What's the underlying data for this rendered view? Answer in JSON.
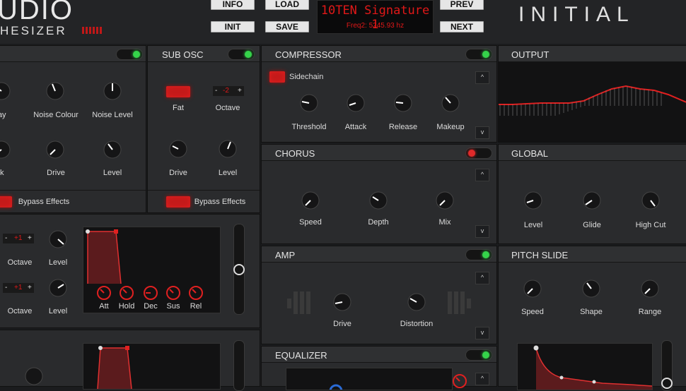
{
  "header": {
    "logo_main": "UDIO",
    "logo_sub": "HESIZER",
    "brand": "INITIAL",
    "buttons": {
      "info": "INFO",
      "load": "LOAD",
      "prev": "PREV",
      "init": "INIT",
      "save": "SAVE",
      "next": "NEXT"
    },
    "preset_name": "10TEN Signature 1",
    "readout": "Freq2: 5245.93 hz"
  },
  "noise": {
    "knob_labels": [
      "cay",
      "Noise Colour",
      "Noise Level",
      "ck",
      "Drive",
      "Level"
    ],
    "bypass": "Bypass Effects"
  },
  "sub_osc": {
    "title": "SUB OSC",
    "fat_label": "Fat",
    "octave_label": "Octave",
    "octave_value": "-2",
    "minus": "-",
    "plus": "+",
    "drive_label": "Drive",
    "level_label": "Level",
    "bypass": "Bypass Effects"
  },
  "osc_left": {
    "octave1_value": "+1",
    "octave2_value": "+1",
    "minus": "-",
    "plus": "+",
    "octave_label": "Octave",
    "level_label": "Level",
    "env_labels": [
      "Att",
      "Hold",
      "Dec",
      "Sus",
      "Rel"
    ]
  },
  "compressor": {
    "title": "COMPRESSOR",
    "sidechain": "Sidechain",
    "knobs": [
      "Threshold",
      "Attack",
      "Release",
      "Makeup"
    ]
  },
  "chorus": {
    "title": "CHORUS",
    "knobs": [
      "Speed",
      "Depth",
      "Mix"
    ]
  },
  "amp": {
    "title": "AMP",
    "knobs": [
      "Drive",
      "Distortion"
    ]
  },
  "equalizer": {
    "title": "EQUALIZER"
  },
  "output": {
    "title": "OUTPUT"
  },
  "global": {
    "title": "GLOBAL",
    "knobs": [
      "Level",
      "Glide",
      "High Cut"
    ]
  },
  "pitch_slide": {
    "title": "PITCH SLIDE",
    "knobs": [
      "Speed",
      "Shape",
      "Range"
    ]
  },
  "arrows": {
    "up": "^",
    "down": "v"
  },
  "colors": {
    "accent": "#e01818",
    "led_on": "#35d34a",
    "panel": "#2a2b2d"
  }
}
